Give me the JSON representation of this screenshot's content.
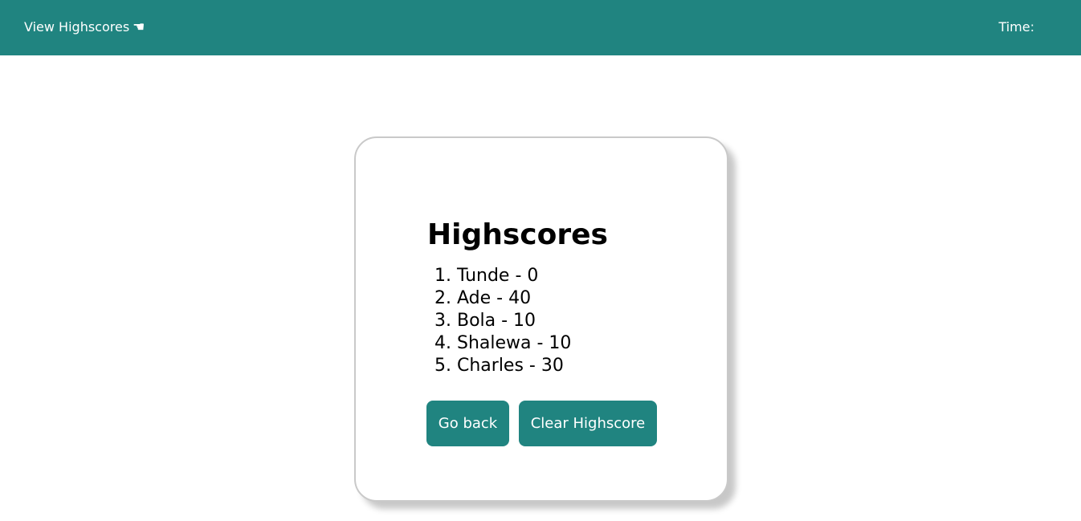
{
  "header": {
    "view_highscores_label": "View Highscores",
    "view_highscores_icon": "pointing-hand-icon",
    "view_highscores_icon_glyph": "☚",
    "time_label": "Time:"
  },
  "highscores": {
    "title": "Highscores",
    "entries": [
      "1. Tunde - 0",
      "2. Ade - 40",
      "3. Bola - 10",
      "4. Shalewa - 10",
      "5. Charles - 30"
    ]
  },
  "buttons": {
    "go_back_label": "Go back",
    "clear_label": "Clear Highscore"
  },
  "colors": {
    "accent": "#208480",
    "card_border": "#c9c9c9",
    "text": "#000000",
    "header_text": "#ffffff"
  }
}
